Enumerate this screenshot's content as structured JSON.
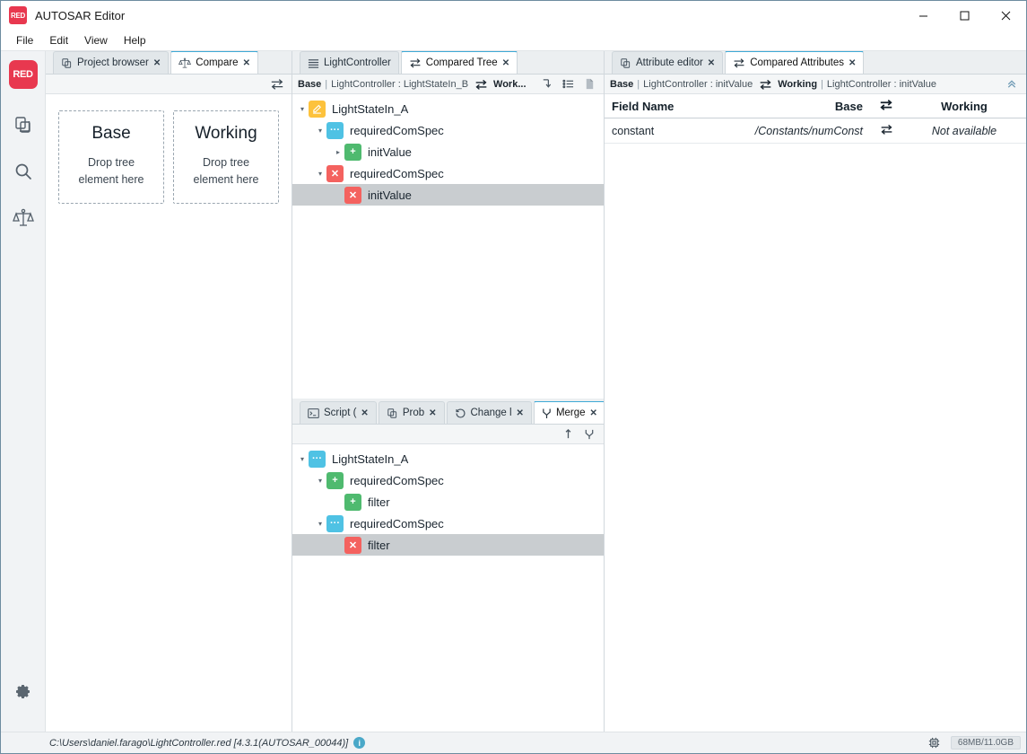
{
  "window": {
    "title": "AUTOSAR Editor",
    "logo_text": "RED",
    "minimize": "—",
    "maximize": "☐",
    "close": "✕"
  },
  "menu": {
    "items": [
      "File",
      "Edit",
      "View",
      "Help"
    ]
  },
  "rail": {
    "logo_text": "RED",
    "items": [
      {
        "name": "project-browser-icon",
        "title": "Project browser"
      },
      {
        "name": "search-icon",
        "title": "Search"
      },
      {
        "name": "compare-icon",
        "title": "Compare"
      }
    ],
    "settings": {
      "name": "gear-icon",
      "title": "Settings"
    }
  },
  "left_panel": {
    "tabs": [
      {
        "label": "Project browser",
        "icon": "project-browser-icon",
        "active": false,
        "closable": true
      },
      {
        "label": "Compare",
        "icon": "compare-icon",
        "active": true,
        "closable": true
      }
    ],
    "toolbar": {
      "swap_icon": "swap-arrows-icon"
    },
    "dropzones": [
      {
        "title": "Base",
        "line1": "Drop tree",
        "line2": "element here"
      },
      {
        "title": "Working",
        "line1": "Drop tree",
        "line2": "element here"
      }
    ]
  },
  "center_top": {
    "tabs": [
      {
        "label": "LightController",
        "icon": "list-icon",
        "active": false,
        "closable": false
      },
      {
        "label": "Compared Tree",
        "icon": "swap-arrows-icon",
        "active": true,
        "closable": true
      }
    ],
    "breadcrumb": {
      "base_label": "Base",
      "base_path": "LightController : LightStateIn_B",
      "swap_icon": "swap-arrows-icon",
      "working_label": "Work...",
      "sep": "|"
    },
    "toolbar_icons": [
      "collapse-down-icon",
      "list-view-icon",
      "document-icon"
    ],
    "tree": [
      {
        "indent": 0,
        "twist": "expanded",
        "icon": "edit",
        "label": "LightStateIn_A",
        "selected": false
      },
      {
        "indent": 1,
        "twist": "expanded",
        "icon": "mod",
        "label": "requiredComSpec",
        "selected": false
      },
      {
        "indent": 2,
        "twist": "collapsed",
        "icon": "add",
        "label": "initValue",
        "selected": false
      },
      {
        "indent": 1,
        "twist": "expanded",
        "icon": "del",
        "label": "requiredComSpec",
        "selected": false
      },
      {
        "indent": 2,
        "twist": "none",
        "icon": "del",
        "label": "initValue",
        "selected": true
      }
    ]
  },
  "center_bottom": {
    "tabs": [
      {
        "label": "Script (",
        "icon": "terminal-icon",
        "active": false,
        "closable": true
      },
      {
        "label": "Prob",
        "icon": "project-browser-icon",
        "active": false,
        "closable": true
      },
      {
        "label": "Change l",
        "icon": "history-icon",
        "active": false,
        "closable": true
      },
      {
        "label": "Merge",
        "icon": "merge-icon",
        "active": true,
        "closable": true
      }
    ],
    "toolbar_icons": [
      "up-arrow-icon",
      "merge-icon"
    ],
    "tree": [
      {
        "indent": 0,
        "twist": "expanded",
        "icon": "mod",
        "label": "LightStateIn_A",
        "selected": false
      },
      {
        "indent": 1,
        "twist": "expanded",
        "icon": "add",
        "label": "requiredComSpec",
        "selected": false
      },
      {
        "indent": 2,
        "twist": "none",
        "icon": "add",
        "label": "filter",
        "selected": false
      },
      {
        "indent": 1,
        "twist": "expanded",
        "icon": "mod",
        "label": "requiredComSpec",
        "selected": false
      },
      {
        "indent": 2,
        "twist": "none",
        "icon": "del",
        "label": "filter",
        "selected": true
      }
    ]
  },
  "right_panel": {
    "tabs": [
      {
        "label": "Attribute editor",
        "icon": "project-browser-icon",
        "active": false,
        "closable": true
      },
      {
        "label": "Compared Attributes",
        "icon": "swap-arrows-icon",
        "active": true,
        "closable": true
      }
    ],
    "breadcrumb": {
      "base_label": "Base",
      "base_path": "LightController : initValue",
      "swap_icon": "swap-arrows-icon",
      "working_label": "Working",
      "working_path": "LightController : initValue",
      "sep": "|",
      "collapse_icon": "chevron-up-double-icon"
    },
    "table": {
      "columns": [
        "Field Name",
        "Base",
        "",
        "Working"
      ],
      "swap_icon": "swap-arrows-icon",
      "rows": [
        {
          "field": "constant",
          "base": "/Constants/numConst",
          "swap": "swap-arrows-icon",
          "working": "Not available"
        }
      ]
    }
  },
  "status_bar": {
    "path": "C:\\Users\\daniel.farago\\LightController.red [4.3.1(AUTOSAR_00044)]",
    "info_icon": "info-icon",
    "memory_icon": "memory-icon",
    "memory": "68MB/11.0GB"
  },
  "colors": {
    "accent": "#3fa9d6",
    "brand_red": "#e8384f",
    "icon_edit": "#fdc23c",
    "icon_modified": "#4fc2e4",
    "icon_added": "#4fba6f",
    "icon_deleted": "#f4625f",
    "selection": "#c9cdd0"
  }
}
